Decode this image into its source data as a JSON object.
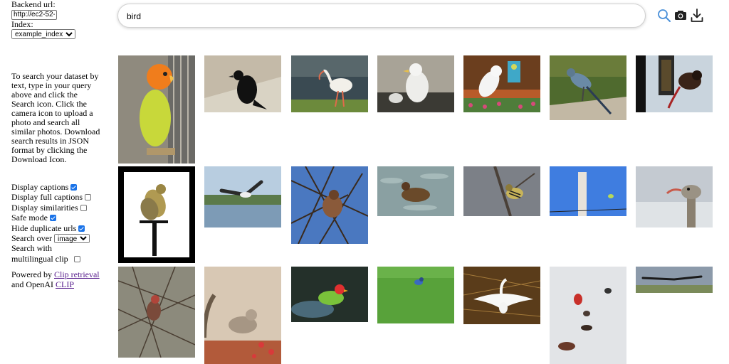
{
  "backend": {
    "label": "Backend url:",
    "value": "http://ec2-52-"
  },
  "index": {
    "label": "Index:",
    "selected": "example_index"
  },
  "help_text": "To search your dataset by text, type in your query above and click the Search icon. Click the camera icon to upload a photo and search all similar photos. Download search results in JSON format by clicking the Download Icon.",
  "options": {
    "display_captions": {
      "label": "Display captions",
      "checked": true
    },
    "display_full_captions": {
      "label": "Display full captions",
      "checked": false
    },
    "display_similarities": {
      "label": "Display similarities",
      "checked": false
    },
    "safe_mode": {
      "label": "Safe mode",
      "checked": true
    },
    "hide_duplicate_urls": {
      "label": "Hide duplicate urls",
      "checked": true
    },
    "search_over": {
      "label": "Search over",
      "selected": "image"
    },
    "multilingual": {
      "label": "Search with multilingual clip",
      "checked": false
    }
  },
  "powered": {
    "prefix": "Powered by",
    "link1": "Clip retrieval",
    "middle": "and OpenAI",
    "link2": "CLIP"
  },
  "search": {
    "query": "bird"
  },
  "icons": {
    "search": "search-icon",
    "camera": "camera-icon",
    "download": "download-icon",
    "search_color": "#4a90d9"
  },
  "results": [
    "lovebird",
    "crow",
    "ibis",
    "gull",
    "cockatoo",
    "heron",
    "feeder-bird",
    "perched-finch-framed",
    "flying-osprey",
    "bird-in-tree",
    "duck",
    "finch-branch",
    "small-bird-pole",
    "ostrich",
    "house-finch",
    "dove",
    "red-headed-bird",
    "blue-jay-grass",
    "egret",
    "cardinals-snow",
    "bird-in-flight"
  ]
}
